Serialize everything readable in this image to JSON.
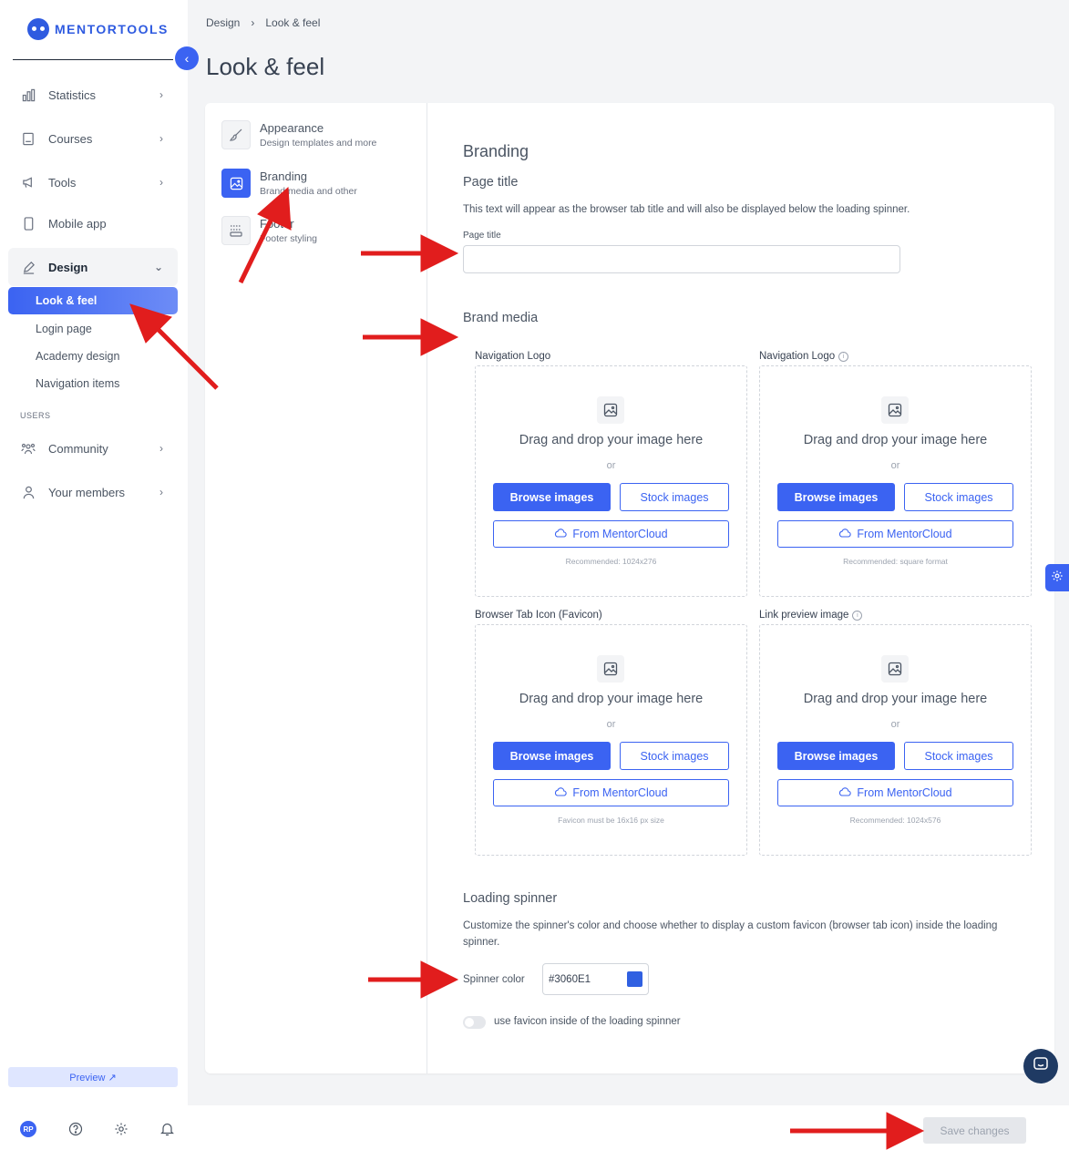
{
  "brand": {
    "name": "MENTORTOOLS",
    "accent": "#3b63f2"
  },
  "sidebar": {
    "items": [
      {
        "label": "Statistics",
        "icon": "bar-chart-icon"
      },
      {
        "label": "Courses",
        "icon": "book-icon"
      },
      {
        "label": "Tools",
        "icon": "megaphone-icon"
      },
      {
        "label": "Mobile app",
        "icon": "phone-icon"
      }
    ],
    "design": {
      "label": "Design",
      "subitems": [
        "Look & feel",
        "Login page",
        "Academy design",
        "Navigation items"
      ]
    },
    "users_label": "USERS",
    "users": [
      {
        "label": "Community",
        "icon": "community-icon"
      },
      {
        "label": "Your members",
        "icon": "user-icon"
      }
    ],
    "preview_label": "Preview ↗",
    "avatar_initials": "RP"
  },
  "breadcrumb": {
    "parent": "Design",
    "current": "Look & feel"
  },
  "page_title": "Look & feel",
  "subnav": [
    {
      "title": "Appearance",
      "subtitle": "Design templates and more"
    },
    {
      "title": "Branding",
      "subtitle": "Brand media and other"
    },
    {
      "title": "Footer",
      "subtitle": "Footer styling"
    }
  ],
  "branding": {
    "heading": "Branding",
    "page_title_heading": "Page title",
    "page_title_desc": "This text will appear as the browser tab title and will also be displayed below the loading spinner.",
    "page_title_field_label": "Page title",
    "page_title_value": "",
    "brand_media_heading": "Brand media",
    "media": [
      {
        "label": "Navigation Logo",
        "info": false,
        "hint": "Recommended: 1024x276"
      },
      {
        "label": "Navigation Logo",
        "info": true,
        "hint": "Recommended: square format"
      },
      {
        "label": "Browser Tab Icon (Favicon)",
        "info": false,
        "hint": "Favicon must be 16x16 px size"
      },
      {
        "label": "Link preview image",
        "info": true,
        "hint": "Recommended: 1024x576"
      }
    ],
    "dropzone": {
      "text": "Drag and drop your image here",
      "or": "or",
      "browse": "Browse images",
      "stock": "Stock images",
      "cloud": "From MentorCloud"
    },
    "spinner_heading": "Loading spinner",
    "spinner_desc": "Customize the spinner's color and choose whether to display a custom favicon (browser tab icon) inside the loading spinner.",
    "spinner_color_label": "Spinner color",
    "spinner_color_value": "#3060E1",
    "spinner_color_swatch": "#3060E1",
    "favicon_toggle_label": "use favicon inside of the loading spinner",
    "favicon_toggle_on": false
  },
  "save_label": "Save changes"
}
